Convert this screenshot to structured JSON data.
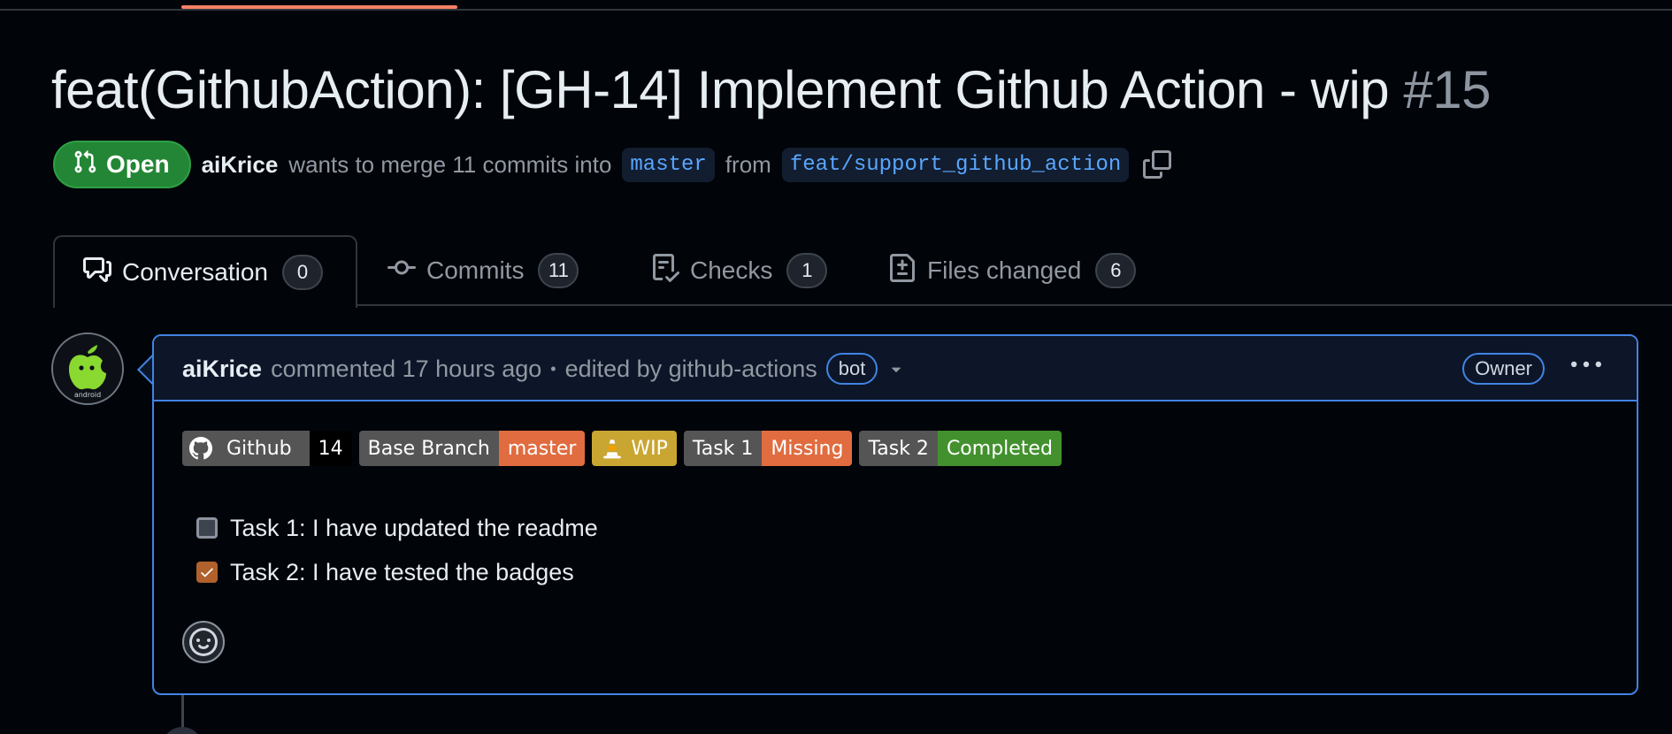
{
  "pr": {
    "title": "feat(GithubAction): [GH-14] Implement Github Action - wip",
    "number": "#15",
    "state": "Open",
    "author": "aiKrice",
    "merge_text": "wants to merge 11 commits into",
    "base_branch": "master",
    "from_text": "from",
    "head_branch": "feat/support_github_action"
  },
  "tabs": [
    {
      "label": "Conversation",
      "count": "0",
      "icon": "comment-discussion-icon"
    },
    {
      "label": "Commits",
      "count": "11",
      "icon": "git-commit-icon"
    },
    {
      "label": "Checks",
      "count": "1",
      "icon": "checklist-icon"
    },
    {
      "label": "Files changed",
      "count": "6",
      "icon": "file-diff-icon"
    }
  ],
  "comment": {
    "author": "aiKrice",
    "action": "commented 17 hours ago",
    "separator": "•",
    "edited_text": "edited by github-actions",
    "bot_label": "bot",
    "role_label": "Owner",
    "avatar_caption": "android",
    "badges": [
      {
        "label": "Github",
        "value": "14",
        "label_color": "#555555",
        "value_color": "#000000",
        "icon": "github-mark-icon"
      },
      {
        "label": "Base Branch",
        "value": "master",
        "label_color": "#555555",
        "value_color": "#e06c40"
      },
      {
        "label": "",
        "value": "WIP",
        "label_color": "#c9a532",
        "value_color": "#c9a532",
        "icon": "traffic-cone-icon"
      },
      {
        "label": "Task 1",
        "value": "Missing",
        "label_color": "#555555",
        "value_color": "#e06c40"
      },
      {
        "label": "Task 2",
        "value": "Completed",
        "label_color": "#555555",
        "value_color": "#43912e"
      }
    ],
    "tasks": [
      {
        "text": "Task 1: I have updated the readme",
        "checked": false
      },
      {
        "text": "Task 2: I have tested the badges",
        "checked": true
      }
    ]
  },
  "colors": {
    "background": "#010409",
    "accent_blue": "#4184e4",
    "open_green": "#238636",
    "tab_underline": "#f78166"
  }
}
